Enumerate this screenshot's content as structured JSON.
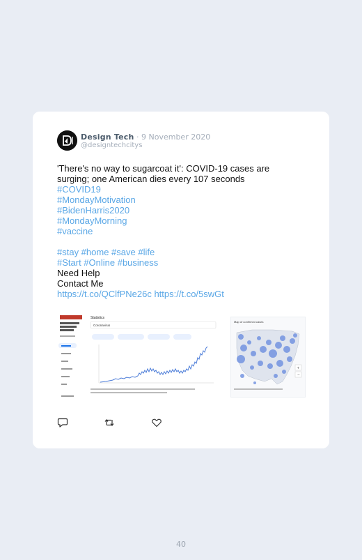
{
  "tweet": {
    "author_name": "Design Tech",
    "date": "· 9 November 2020",
    "handle": "@designtechcitys",
    "lines": [
      "'There's no way to sugarcoat it': COVID-19 cases are",
      "surging; one American dies every 107 seconds"
    ],
    "hashtags": [
      "#COVID19",
      "#MondayMotivation",
      "#BidenHarris2020",
      "#MondayMorning",
      "#vaccine"
    ],
    "tag_line_1": "#stay #home #save #life",
    "tag_line_2": "#Start #Online #business",
    "plain_1": "Need Help",
    "plain_2": "Contact Me",
    "links": "https://t.co/QClfPNe26c https://t.co/5swGt",
    "media": {
      "chart_title": "Statistics",
      "chart_subtitle": "Coronavirus",
      "map_title": "Map of confirmed cases"
    }
  },
  "actions": {
    "reply": "reply-icon",
    "retweet": "retweet-icon",
    "like": "heart-icon"
  },
  "footer": {
    "page_number": "40"
  },
  "colors": {
    "link": "#5aa7e6",
    "background": "#e9edf4",
    "card": "#ffffff"
  }
}
